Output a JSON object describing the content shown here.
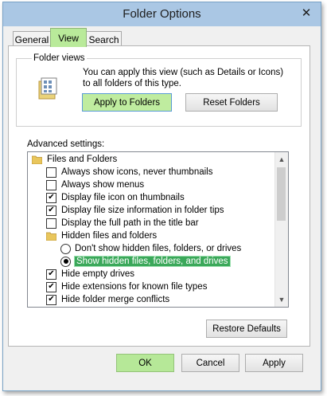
{
  "window": {
    "title": "Folder Options"
  },
  "tabs": [
    {
      "label": "General",
      "active": false
    },
    {
      "label": "View",
      "active": true
    },
    {
      "label": "Search",
      "active": false
    }
  ],
  "folder_views": {
    "group_label": "Folder views",
    "description": "You can apply this view (such as Details or Icons) to all folders of this type.",
    "apply_button": "Apply to Folders",
    "reset_button": "Reset Folders"
  },
  "advanced": {
    "label": "Advanced settings:",
    "items": [
      {
        "kind": "folder",
        "label": "Files and Folders"
      },
      {
        "kind": "checkbox",
        "label": "Always show icons, never thumbnails",
        "checked": false
      },
      {
        "kind": "checkbox",
        "label": "Always show menus",
        "checked": false
      },
      {
        "kind": "checkbox",
        "label": "Display file icon on thumbnails",
        "checked": true
      },
      {
        "kind": "checkbox",
        "label": "Display file size information in folder tips",
        "checked": true
      },
      {
        "kind": "checkbox",
        "label": "Display the full path in the title bar",
        "checked": false
      },
      {
        "kind": "folder",
        "label": "Hidden files and folders"
      },
      {
        "kind": "radio",
        "label": "Don't show hidden files, folders, or drives",
        "checked": false
      },
      {
        "kind": "radio",
        "label": "Show hidden files, folders, and drives",
        "checked": true,
        "selected": true
      },
      {
        "kind": "checkbox",
        "label": "Hide empty drives",
        "checked": true
      },
      {
        "kind": "checkbox",
        "label": "Hide extensions for known file types",
        "checked": true
      },
      {
        "kind": "checkbox",
        "label": "Hide folder merge conflicts",
        "checked": true
      }
    ]
  },
  "buttons": {
    "restore_defaults": "Restore Defaults",
    "ok": "OK",
    "cancel": "Cancel",
    "apply": "Apply"
  },
  "icons": {
    "close": "close-icon",
    "folder": "folder-icon",
    "folder_view": "folder-view-icon",
    "check": "✔",
    "scroll_up": "▲",
    "scroll_down": "▼"
  },
  "colors": {
    "titlebar": "#aac7e4",
    "highlight_green": "#b9ea9a",
    "selection": "#3ba85a"
  }
}
